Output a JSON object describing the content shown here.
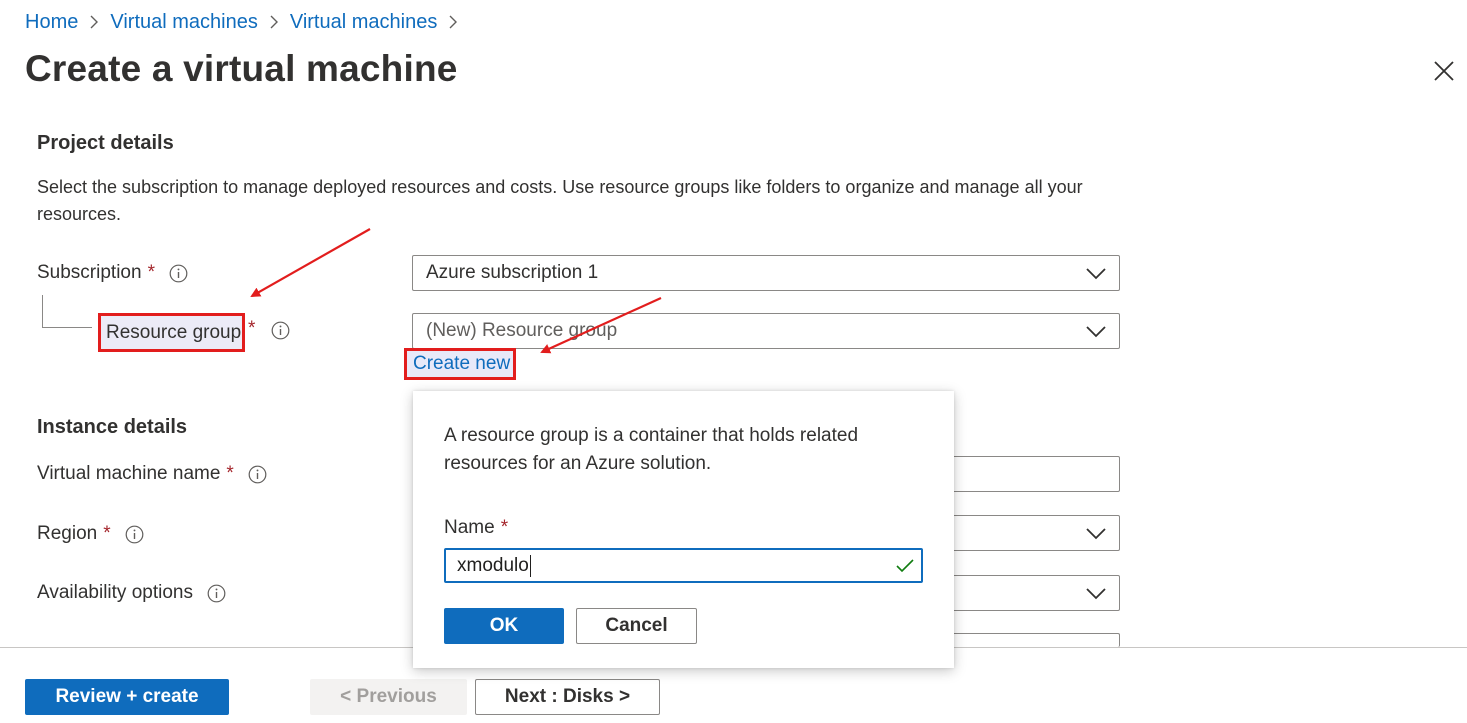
{
  "breadcrumb": {
    "items": [
      "Home",
      "Virtual machines",
      "Virtual machines"
    ]
  },
  "page": {
    "title": "Create a virtual machine"
  },
  "project_details": {
    "heading": "Project details",
    "description": "Select the subscription to manage deployed resources and costs. Use resource groups like folders to organize and manage all your resources.",
    "subscription_label": "Subscription",
    "subscription_value": "Azure subscription 1",
    "resource_group_label": "Resource group",
    "resource_group_value": "(New) Resource group",
    "create_new_link": "Create new"
  },
  "instance_details": {
    "heading": "Instance details",
    "vm_name_label": "Virtual machine name",
    "region_label": "Region",
    "availability_label": "Availability options"
  },
  "callout": {
    "text": "A resource group is a container that holds related resources for an Azure solution.",
    "name_label": "Name",
    "name_value": "xmodulo",
    "ok_label": "OK",
    "cancel_label": "Cancel"
  },
  "footer": {
    "review_create_label": "Review + create",
    "previous_label": "< Previous",
    "next_label": "Next : Disks >"
  },
  "required_marker": "*",
  "colors": {
    "accent": "#0f6cbd",
    "annotation_red": "#e21d1d",
    "required_red": "#a4262c",
    "valid_green": "#107c10"
  },
  "icons": [
    "chevron-right-icon",
    "close-icon",
    "info-icon",
    "chevron-down-icon",
    "checkmark-icon"
  ]
}
